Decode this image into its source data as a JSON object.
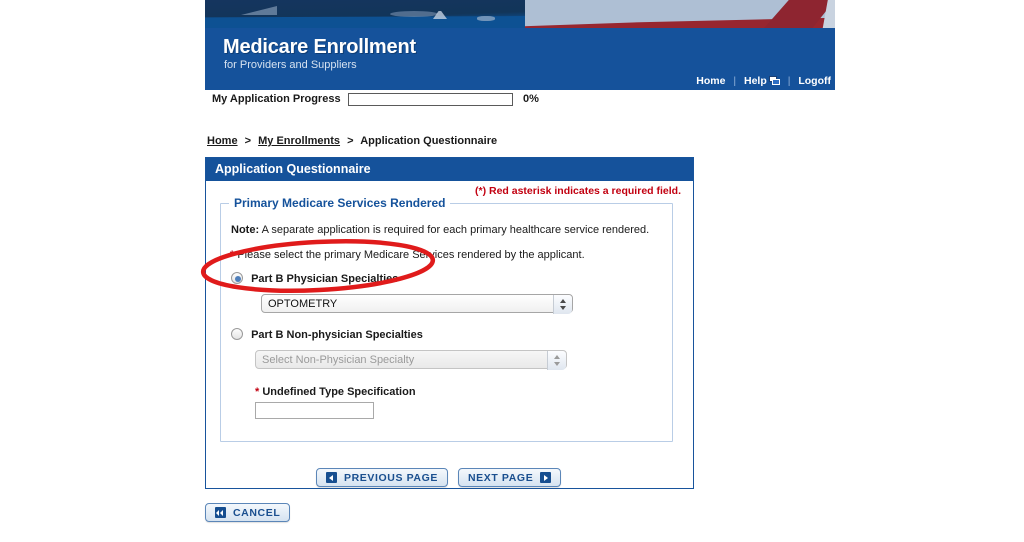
{
  "banner": {
    "title": "Medicare Enrollment",
    "subtitle": "for Providers and Suppliers",
    "nav": {
      "home": "Home",
      "help": "Help",
      "logoff": "Logoff",
      "separator": "|",
      "help_icon": "new-window-popup-icon"
    },
    "accent_blue": "#15529b"
  },
  "progress": {
    "label": "My Application Progress",
    "percent_text": "0%",
    "percent_value": 0
  },
  "breadcrumb": {
    "items": [
      {
        "label": "Home",
        "link": true
      },
      {
        "label": "My Enrollments",
        "link": true
      },
      {
        "label": "Application Questionnaire",
        "link": false
      }
    ],
    "separator": ">"
  },
  "panel": {
    "heading": "Application Questionnaire",
    "required_note": "(*) Red asterisk indicates a required field.",
    "required_note_color": "#c20010",
    "fieldset": {
      "legend": "Primary Medicare Services Rendered",
      "note_label": "Note:",
      "note_text": "A separate application is required for each primary healthcare service rendered.",
      "instruction": "Please select the primary Medicare Services rendered by the applicant.",
      "instruction_asterisk": "*",
      "options": [
        {
          "label": "Part B Physician Specialties",
          "selected": true,
          "select": {
            "value": "OPTOMETRY",
            "disabled": false,
            "options": [
              "OPTOMETRY"
            ]
          }
        },
        {
          "label": "Part B Non-physician Specialties",
          "selected": false,
          "select": {
            "value": "Select Non-Physician Specialty",
            "disabled": true,
            "options": [
              "Select Non-Physician Specialty"
            ]
          }
        }
      ],
      "undefined_type": {
        "asterisk": "*",
        "label": "Undefined Type Specification",
        "value": "",
        "placeholder": ""
      }
    }
  },
  "buttons": {
    "previous": {
      "label": "PREVIOUS PAGE",
      "icon": "arrow-left-icon"
    },
    "next": {
      "label": "NEXT PAGE",
      "icon": "arrow-right-icon"
    },
    "cancel": {
      "label": "CANCEL",
      "icon": "double-chevron-left-icon"
    }
  },
  "annotation": {
    "shape": "ellipse",
    "color": "#e01b1b",
    "targets": "Part B Physician Specialties radio option"
  }
}
